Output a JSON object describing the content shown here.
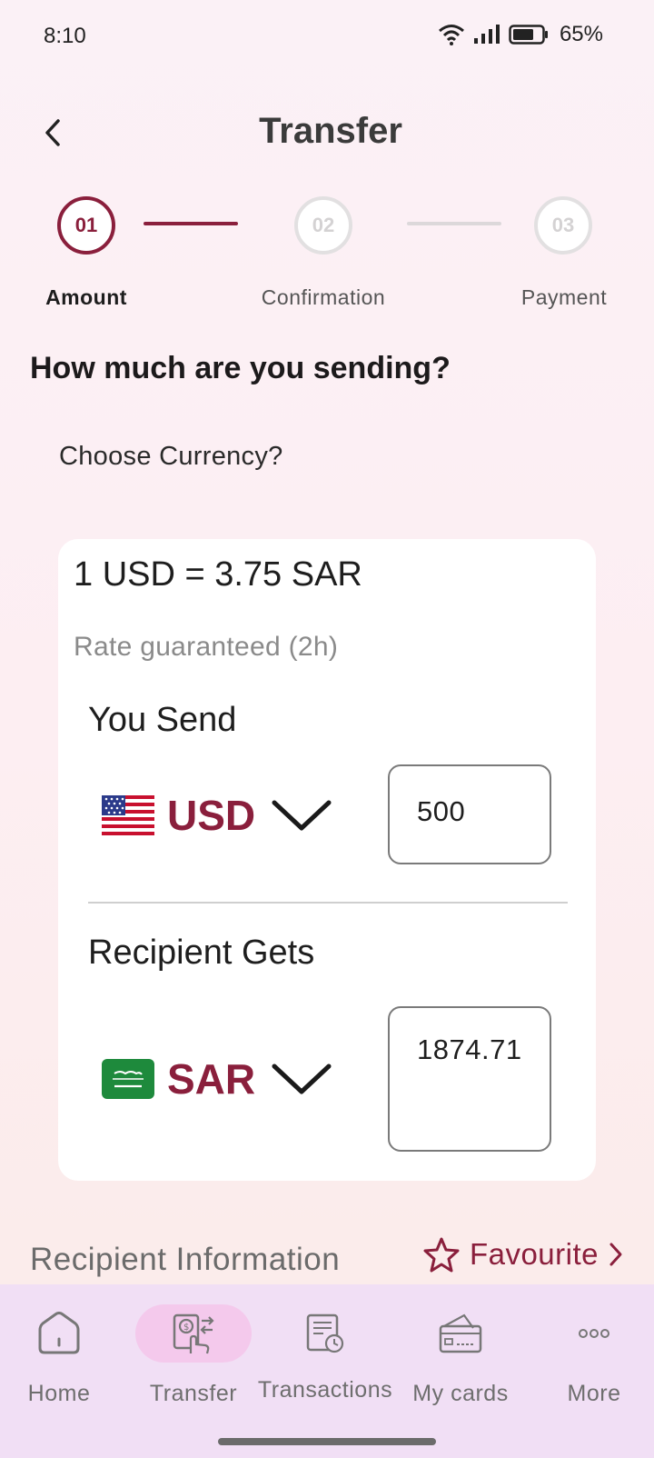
{
  "status_bar": {
    "time": "8:10",
    "battery": "65%"
  },
  "header": {
    "title": "Transfer"
  },
  "stepper": {
    "steps": [
      {
        "number": "01",
        "label": "Amount",
        "active": true
      },
      {
        "number": "02",
        "label": "Confirmation",
        "active": false
      },
      {
        "number": "03",
        "label": "Payment",
        "active": false
      }
    ]
  },
  "main": {
    "question": "How much are you sending?",
    "choose_currency": "Choose Currency?",
    "card": {
      "rate": "1 USD = 3.75 SAR",
      "rate_note": "Rate guaranteed (2h)",
      "send": {
        "label": "You Send",
        "currency": "USD",
        "amount": "500"
      },
      "receive": {
        "label": "Recipient Gets",
        "currency": "SAR",
        "amount": "1874.71"
      }
    },
    "recipient": {
      "title": "Recipient Information",
      "favourite": "Favourite"
    }
  },
  "bottom_nav": {
    "items": [
      {
        "label": "Home",
        "icon": "home-icon"
      },
      {
        "label": "Transfer",
        "icon": "transfer-icon",
        "active": true
      },
      {
        "label": "Transactions",
        "icon": "transactions-icon"
      },
      {
        "label": "My cards",
        "icon": "card-icon"
      },
      {
        "label": "More",
        "icon": "more-icon"
      }
    ]
  },
  "colors": {
    "accent": "#8a1f3c",
    "nav_bg": "#f1dff5",
    "nav_active": "#f4c9ec"
  }
}
